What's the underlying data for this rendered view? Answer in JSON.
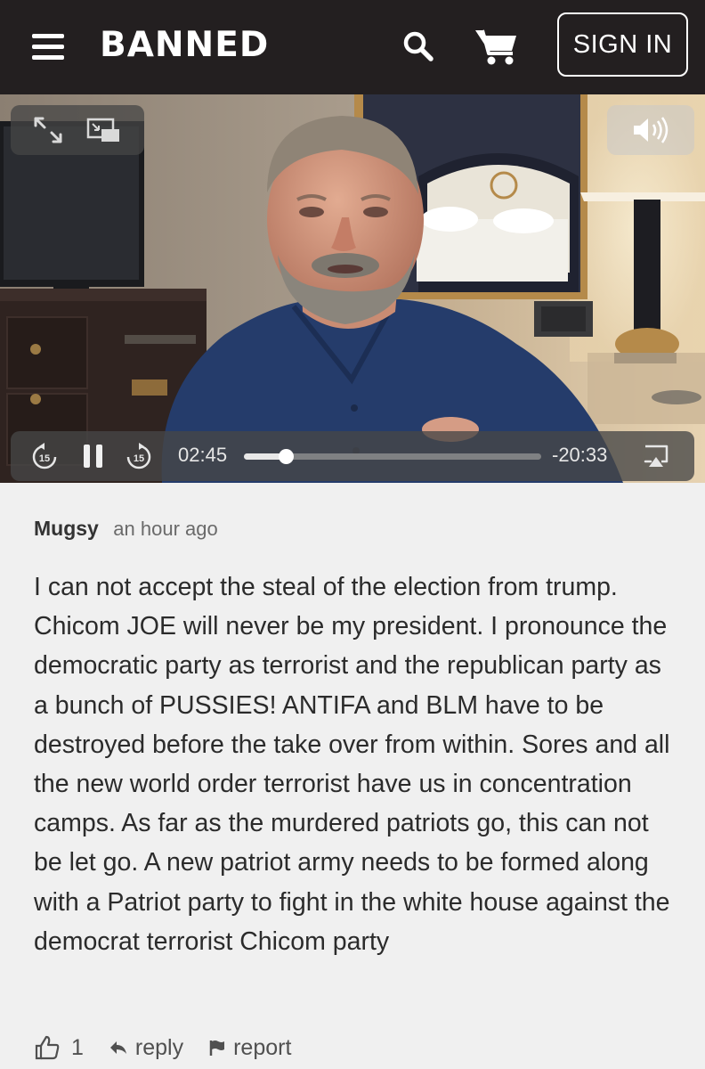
{
  "header": {
    "logo": "BANNED",
    "sign_in_label": "SIGN IN",
    "icons": [
      "hamburger-menu-icon",
      "search-icon",
      "cart-icon"
    ]
  },
  "video": {
    "icons": [
      "expand-icon",
      "picture-in-picture-icon",
      "speaker-icon",
      "skip-back-15-icon",
      "pause-icon",
      "skip-forward-15-icon",
      "airplay-icon"
    ],
    "skip_back_label": "15",
    "skip_forward_label": "15",
    "elapsed": "02:45",
    "remaining": "-20:33",
    "progress": 0.118
  },
  "comment": {
    "author": "Mugsy",
    "time": "an hour ago",
    "body": "I can not accept the steal of the election from trump. Chicom JOE will never be my president. I pronounce the democratic party as terrorist and the republican party as a bunch of PUSSIES! ANTIFA and BLM have to be destroyed before the take over from within. Sores and all the new world order terrorist have us in concentration camps.  As far as the murdered patriots go, this can not be let go. A new patriot army needs to be formed along with a Patriot party to fight in the white house against the democrat terrorist Chicom party",
    "likes": "1",
    "reply_label": "reply",
    "report_label": "report"
  },
  "colors": {
    "header_bg": "#231f20",
    "page_bg": "#f0f0f0",
    "shirt": "#253c6b"
  }
}
